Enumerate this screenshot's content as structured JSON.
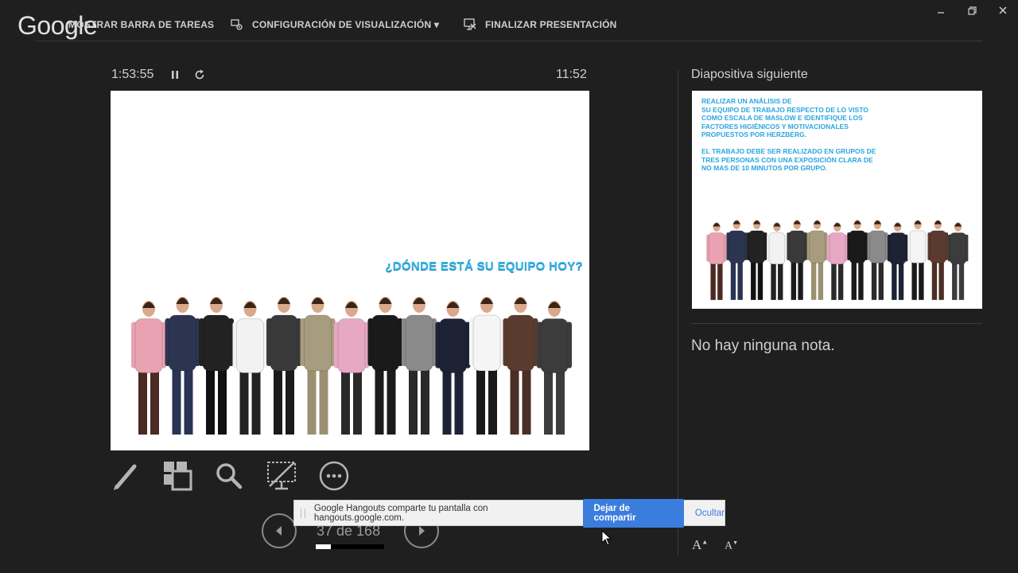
{
  "watermark": "Google",
  "toolbar": {
    "show_taskbar": "MOSTRAR BARRA DE TAREAS",
    "display_settings": "CONFIGURACIÓN DE VISUALIZACIÓN ▾",
    "end_presentation": "FINALIZAR PRESENTACIÓN"
  },
  "presenter": {
    "timer": "1:53:55",
    "clock": "11:52",
    "current_slide_title": "¿DÓNDE ESTÁ SU EQUIPO HOY?",
    "slide_counter": "37 de 168",
    "progress_fraction": 0.22
  },
  "next_slide": {
    "label": "Diapositiva siguiente",
    "text": "REALIZAR UN ANÁLISIS DE\nSU EQUIPO DE TRABAJO RESPECTO DE LO VISTO COMO ESCALA DE MASLOW E IDENTIFIQUE LOS FACTORES HIGIÉNICOS Y MOTIVACIONALES PROPUESTOS POR HERZBERG.\n\nEL TRABAJO DEBE SER REALIZADO EN GRUPOS DE TRES PERSONAS CON UNA EXPOSICIÓN CLARA DE NO MAS DE 10 MINUTOS POR GRUPO."
  },
  "notes": {
    "text": "No hay ninguna nota."
  },
  "font_controls": {
    "increase": "A",
    "decrease": "A"
  },
  "share_bar": {
    "message": "Google Hangouts comparte tu pantalla con hangouts.google.com.",
    "stop_button": "Dejar de compartir",
    "hide_link": "Ocultar"
  },
  "colors": {
    "background": "#1f1f1f",
    "slide_title": "#37b3e6",
    "share_button": "#3b7ddd"
  },
  "people_colors": {
    "tops": [
      "#e8a2b2",
      "#2c3550",
      "#222222",
      "#f2f2f2",
      "#3a3a3a",
      "#a89c7e",
      "#e6a8c4",
      "#1a1a1a",
      "#8a8a8a",
      "#1d2335",
      "#f5f5f5",
      "#5b3b2f",
      "#3c3c3c"
    ],
    "bottoms": [
      "#4a2a22",
      "#2a3352",
      "#111111",
      "#222222",
      "#1b1b1b",
      "#9b9072",
      "#2a2a2a",
      "#1b1b1b",
      "#2a2a2a",
      "#1d2335",
      "#1a1a1a",
      "#4b2e26",
      "#3c3c3c"
    ]
  }
}
